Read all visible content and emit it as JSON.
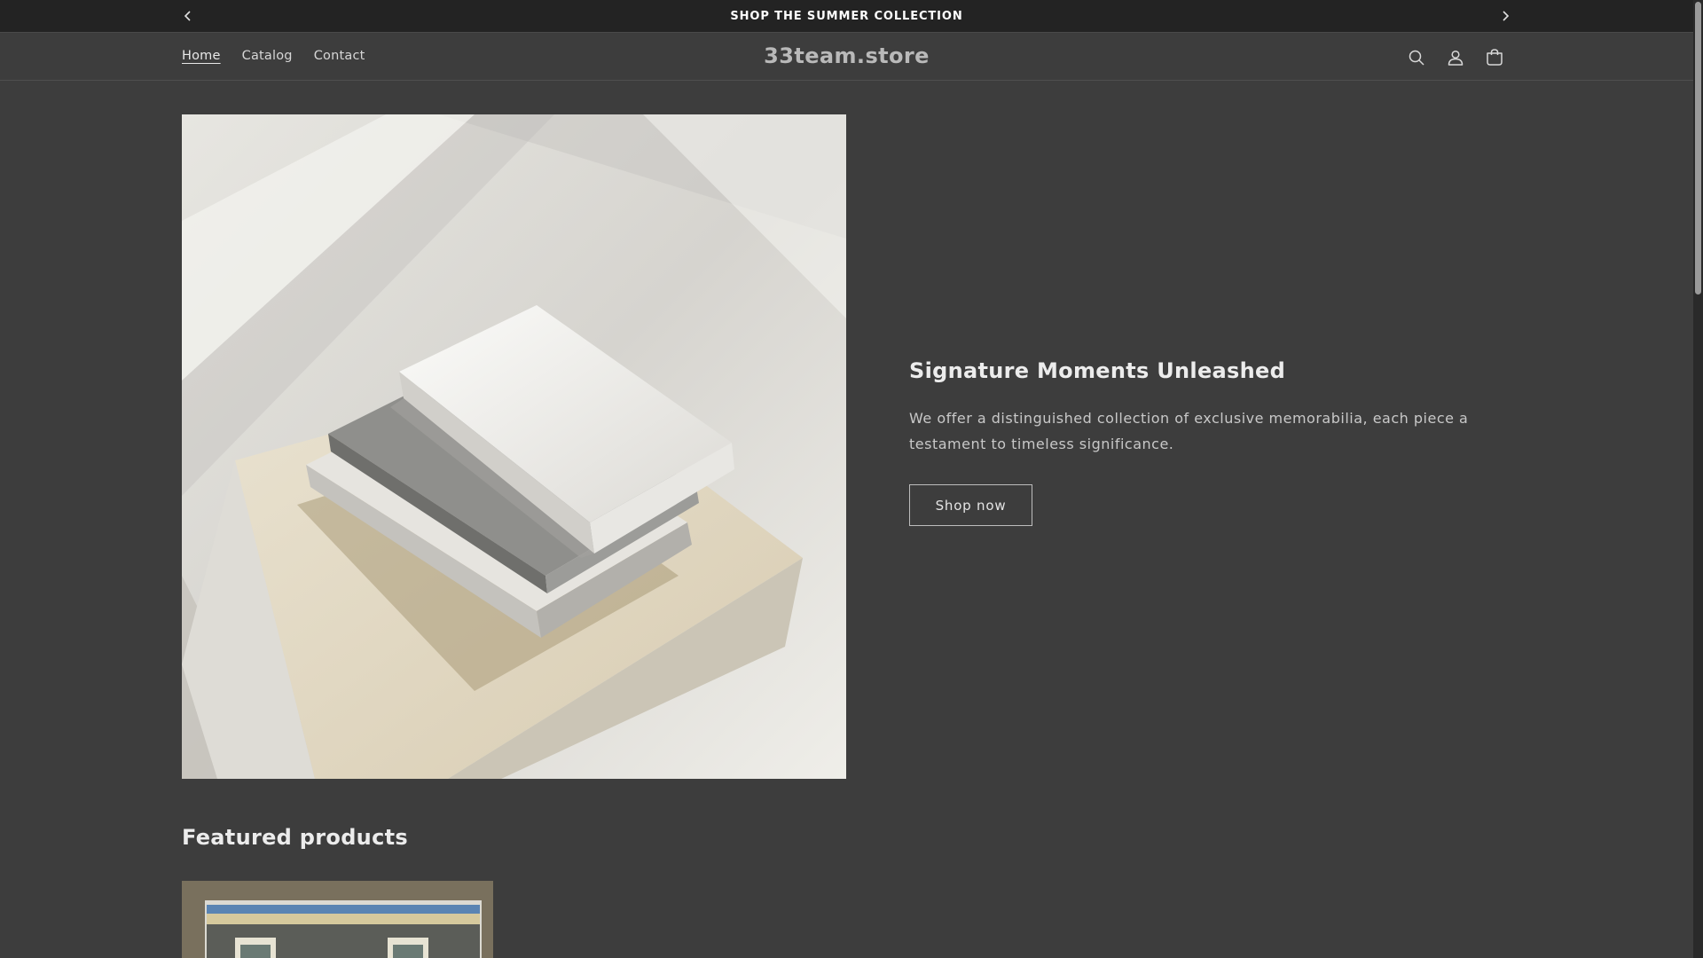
{
  "announcement": {
    "text": "SHOP THE SUMMER COLLECTION",
    "prev_icon": "chevron-left-icon",
    "next_icon": "chevron-right-icon"
  },
  "header": {
    "nav": [
      {
        "label": "Home",
        "active": true
      },
      {
        "label": "Catalog",
        "active": false
      },
      {
        "label": "Contact",
        "active": false
      }
    ],
    "logo": "33team.store",
    "icons": [
      "search-icon",
      "account-icon",
      "cart-icon"
    ]
  },
  "hero": {
    "heading": "Signature Moments Unleashed",
    "description": "We offer a distinguished collection of exclusive memorabilia, each piece a testament to timeless significance.",
    "button_label": "Shop now"
  },
  "featured": {
    "heading": "Featured products"
  },
  "colors": {
    "background": "#3d3d3d",
    "announcement_bg": "#232323",
    "text": "#e8e8e8"
  }
}
